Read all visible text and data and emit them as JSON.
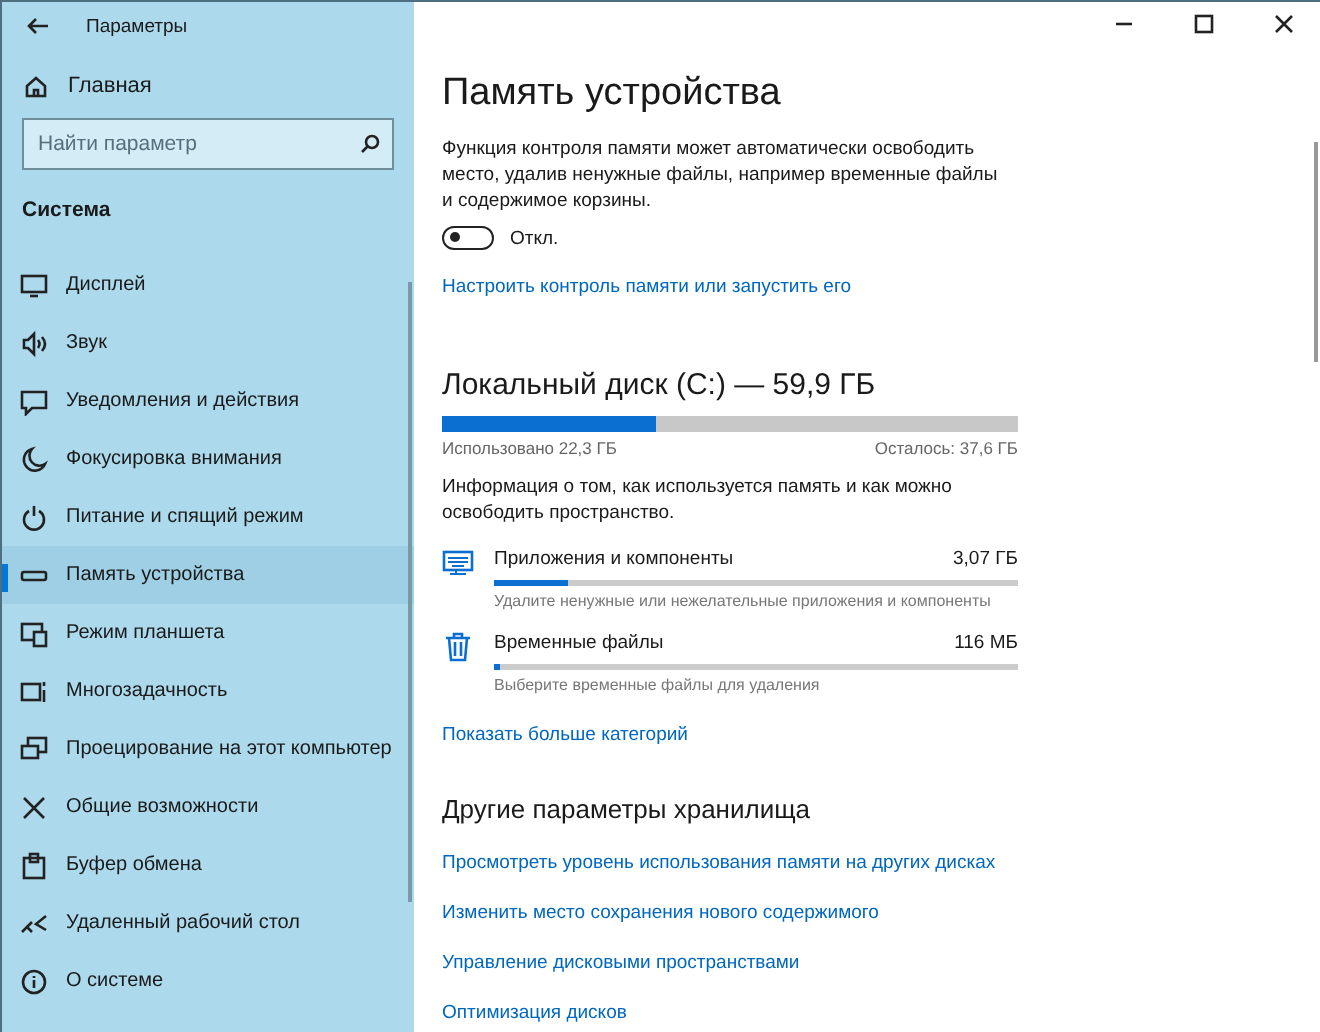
{
  "window": {
    "title": "Параметры"
  },
  "sidebar": {
    "home": "Главная",
    "search": {
      "placeholder": "Найти параметр"
    },
    "section": "Система",
    "items": [
      {
        "label": "Дисплей",
        "selected": false
      },
      {
        "label": "Звук",
        "selected": false
      },
      {
        "label": "Уведомления и действия",
        "selected": false
      },
      {
        "label": "Фокусировка внимания",
        "selected": false
      },
      {
        "label": "Питание и спящий режим",
        "selected": false
      },
      {
        "label": "Память устройства",
        "selected": true
      },
      {
        "label": "Режим планшета",
        "selected": false
      },
      {
        "label": "Многозадачность",
        "selected": false
      },
      {
        "label": "Проецирование на этот компьютер",
        "selected": false
      },
      {
        "label": "Общие возможности",
        "selected": false
      },
      {
        "label": "Буфер обмена",
        "selected": false
      },
      {
        "label": "Удаленный рабочий стол",
        "selected": false
      },
      {
        "label": "О системе",
        "selected": false
      }
    ]
  },
  "page": {
    "title": "Память устройства",
    "description": "Функция контроля памяти может автоматически освободить место, удалив ненужные файлы, например временные файлы и содержимое корзины.",
    "toggle": {
      "on": false,
      "label": "Откл."
    },
    "configure_link": "Настроить контроль памяти или запустить его",
    "disk": {
      "title": "Локальный диск (C:) — 59,9 ГБ",
      "level": 0.372,
      "used": "Использовано 22,3 ГБ",
      "remaining": "Осталось: 37,6 ГБ"
    },
    "info": "Информация о том, как используется память и как можно освободить пространство.",
    "categories": [
      {
        "name": "Приложения и компоненты",
        "size": "3,07 ГБ",
        "level": 0.14,
        "hint": "Удалите ненужные или нежелательные приложения и компоненты"
      },
      {
        "name": "Временные файлы",
        "size": "116 МБ",
        "level": 0.01,
        "hint": "Выберите временные файлы для удаления"
      }
    ],
    "more_link": "Показать больше категорий",
    "other_heading": "Другие параметры хранилища",
    "other_links": [
      "Просмотреть уровень использования памяти на других дисках",
      "Изменить место сохранения нового содержимого",
      "Управление дисковыми пространствами",
      "Оптимизация дисков"
    ]
  }
}
